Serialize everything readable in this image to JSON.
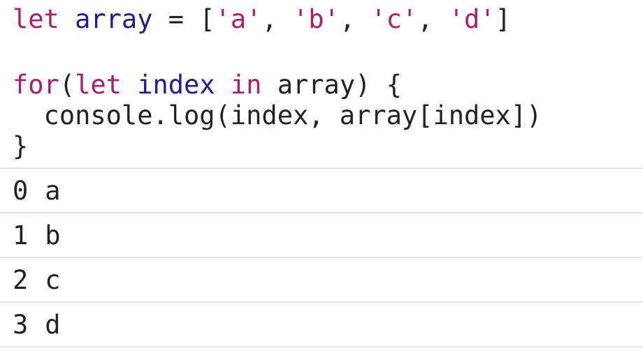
{
  "code": {
    "line1": {
      "kw_let": "let",
      "var_array": "array",
      "op_eq": " = ",
      "open": "[",
      "s_a": "'a'",
      "s_b": "'b'",
      "s_c": "'c'",
      "s_d": "'d'",
      "comma": ", ",
      "close": "]"
    },
    "line3": {
      "kw_for": "for",
      "paren_open": "(",
      "kw_let": "let",
      "var_index": "index",
      "kw_in": "in",
      "rest": " array) {"
    },
    "line4": "  console.log(index, array[index])",
    "line5": "}"
  },
  "output": [
    {
      "index": "0",
      "value": "a"
    },
    {
      "index": "1",
      "value": "b"
    },
    {
      "index": "2",
      "value": "c"
    },
    {
      "index": "3",
      "value": "d"
    }
  ],
  "colors": {
    "keyword": "#aa1e6f",
    "variable": "#1e1e8c",
    "string": "#aa1e6f",
    "text": "#222222",
    "divider": "#e6e6e6"
  }
}
